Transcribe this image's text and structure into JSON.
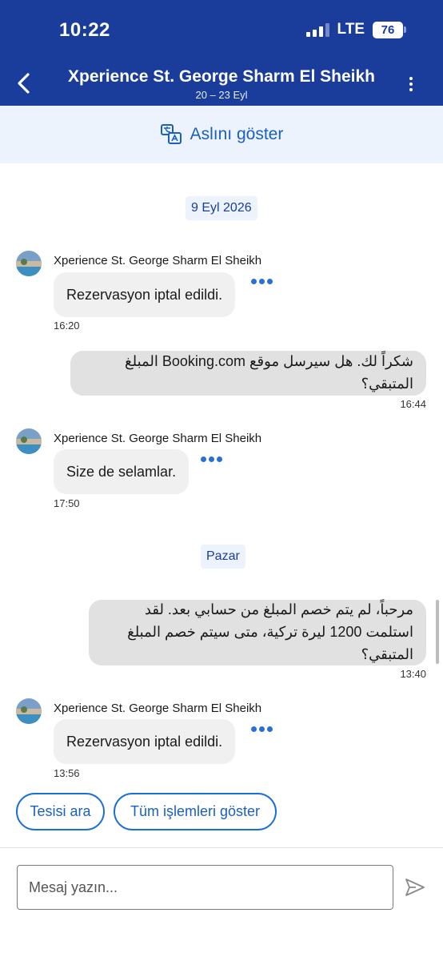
{
  "status_bar": {
    "time": "10:22",
    "network": "LTE",
    "battery": "76"
  },
  "header": {
    "title": "Xperience St. George Sharm El Sheikh",
    "dates": "20 – 23 Eyl",
    "back_icon": "chevron-left-icon",
    "more_icon": "vertical-dots-icon"
  },
  "translate_bar": {
    "label": "Aslını göster",
    "icon": "translate-icon"
  },
  "chat": {
    "date_separators": [
      "9 Eyl 2026",
      "Pazar"
    ],
    "messages": [
      {
        "direction": "incoming",
        "sender": "Xperience St. George Sharm El Sheikh",
        "text": "Rezervasyon iptal edildi.",
        "time": "16:20"
      },
      {
        "direction": "outgoing",
        "text": "شكراً لك. هل سيرسل موقع Booking.com المبلغ المتبقي؟",
        "time": "16:44"
      },
      {
        "direction": "incoming",
        "sender": "Xperience St. George Sharm El Sheikh",
        "text": "Size de selamlar.",
        "time": "17:50"
      },
      {
        "direction": "outgoing",
        "text": "مرحباً، لم يتم خصم المبلغ من حسابي بعد. لقد استلمت 1200 ليرة تركية، متى سيتم خصم المبلغ المتبقي؟",
        "time": "13:40"
      },
      {
        "direction": "incoming",
        "sender": "Xperience St. George Sharm El Sheikh",
        "text": "Rezervasyon iptal edildi.",
        "time": "13:56"
      }
    ]
  },
  "quick_actions": [
    "Tesisi ara",
    "Tüm işlemleri göster"
  ],
  "composer": {
    "placeholder": "Mesaj yazın...",
    "send_icon": "send-icon"
  },
  "colors": {
    "header_bg": "#1a3d9c",
    "accent": "#1a6fd6",
    "translate_bg": "#ecf3fd",
    "outgoing_bubble": "#e1e1e1",
    "incoming_bubble": "#f0f0f0"
  }
}
